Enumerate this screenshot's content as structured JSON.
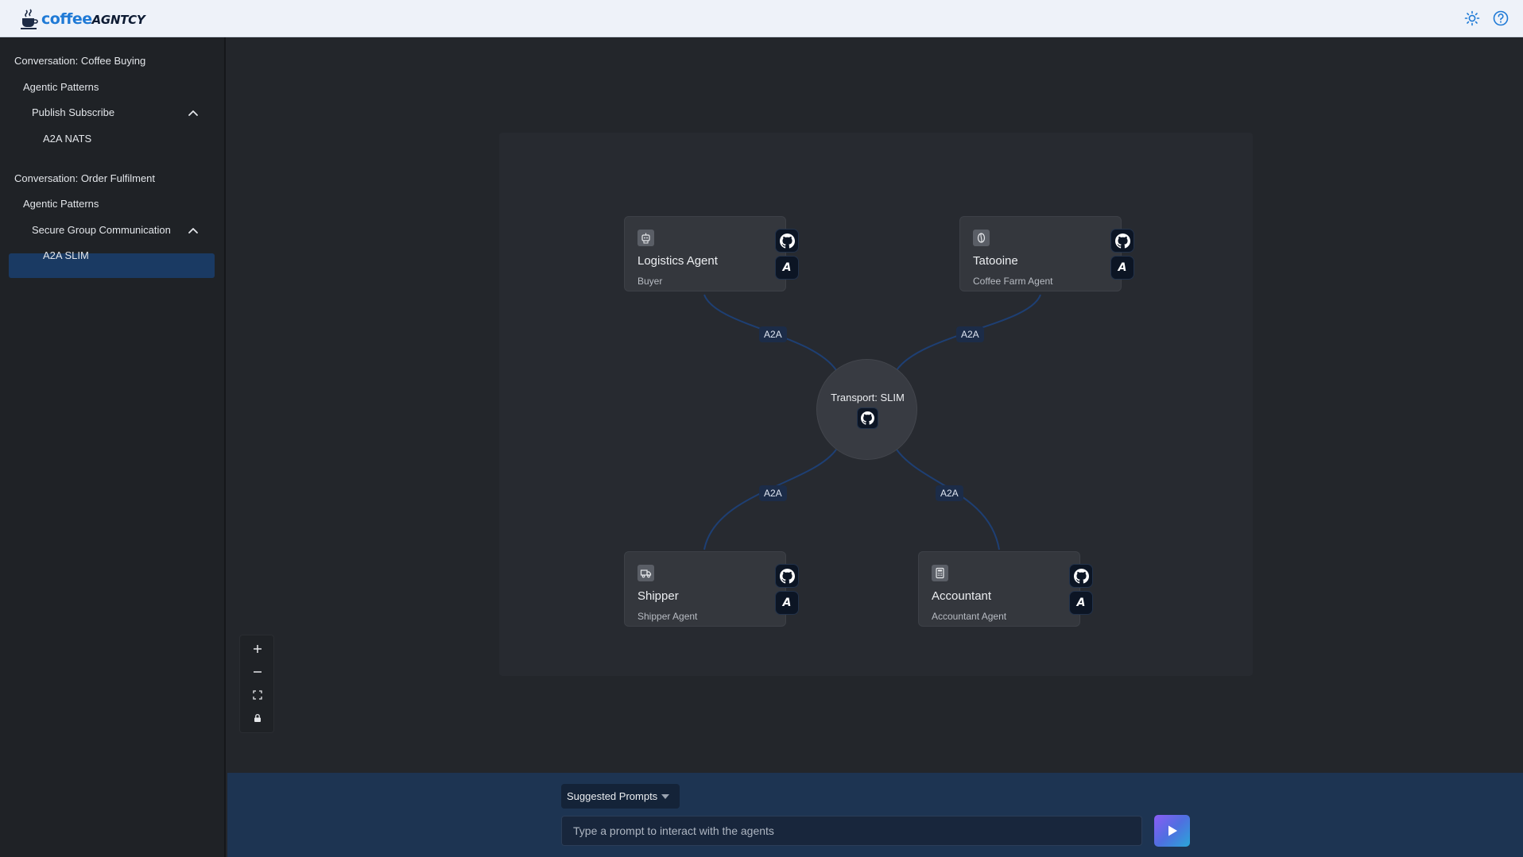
{
  "header": {
    "logo_primary": "coffee",
    "logo_secondary": "AGNTCY",
    "theme_toggle_icon": "sun-icon",
    "help_icon": "help-circle-icon"
  },
  "sidebar": {
    "items": [
      {
        "label": "Conversation: Coffee Buying",
        "level": 0
      },
      {
        "label": "Agentic Patterns",
        "level": 1
      },
      {
        "label": "Publish Subscribe",
        "level": 2,
        "expanded": true
      },
      {
        "label": "A2A NATS",
        "level": 3
      },
      {
        "label": "Conversation: Order Fulfilment",
        "level": 0
      },
      {
        "label": "Agentic Patterns",
        "level": 1
      },
      {
        "label": "Secure Group Communication",
        "level": 2,
        "expanded": true
      },
      {
        "label": "A2A SLIM",
        "level": 3,
        "selected": true
      }
    ],
    "active_bg": "#1a3a63"
  },
  "graph": {
    "transport": {
      "label": "Transport: SLIM",
      "icon": "github-icon"
    },
    "agents": [
      {
        "title": "Logistics Agent",
        "subtitle": "Buyer",
        "icon": "robot-icon"
      },
      {
        "title": "Tatooine",
        "subtitle": "Coffee Farm Agent",
        "icon": "coffee-bean-icon"
      },
      {
        "title": "Shipper",
        "subtitle": "Shipper Agent",
        "icon": "truck-icon"
      },
      {
        "title": "Accountant",
        "subtitle": "Accountant Agent",
        "icon": "calculator-icon"
      }
    ],
    "edge_labels": [
      "A2A",
      "A2A",
      "A2A",
      "A2A"
    ],
    "edge_color": "#1e3f73"
  },
  "controls": [
    "zoom-in",
    "zoom-out",
    "fit-view",
    "lock"
  ],
  "prompt": {
    "suggested_label": "Suggested Prompts",
    "placeholder": "Type a prompt to interact with the agents",
    "value": ""
  },
  "colors": {
    "accent": "#1f7ad6",
    "send_gradient": [
      "#8b5cf6",
      "#2aa6d8"
    ]
  }
}
